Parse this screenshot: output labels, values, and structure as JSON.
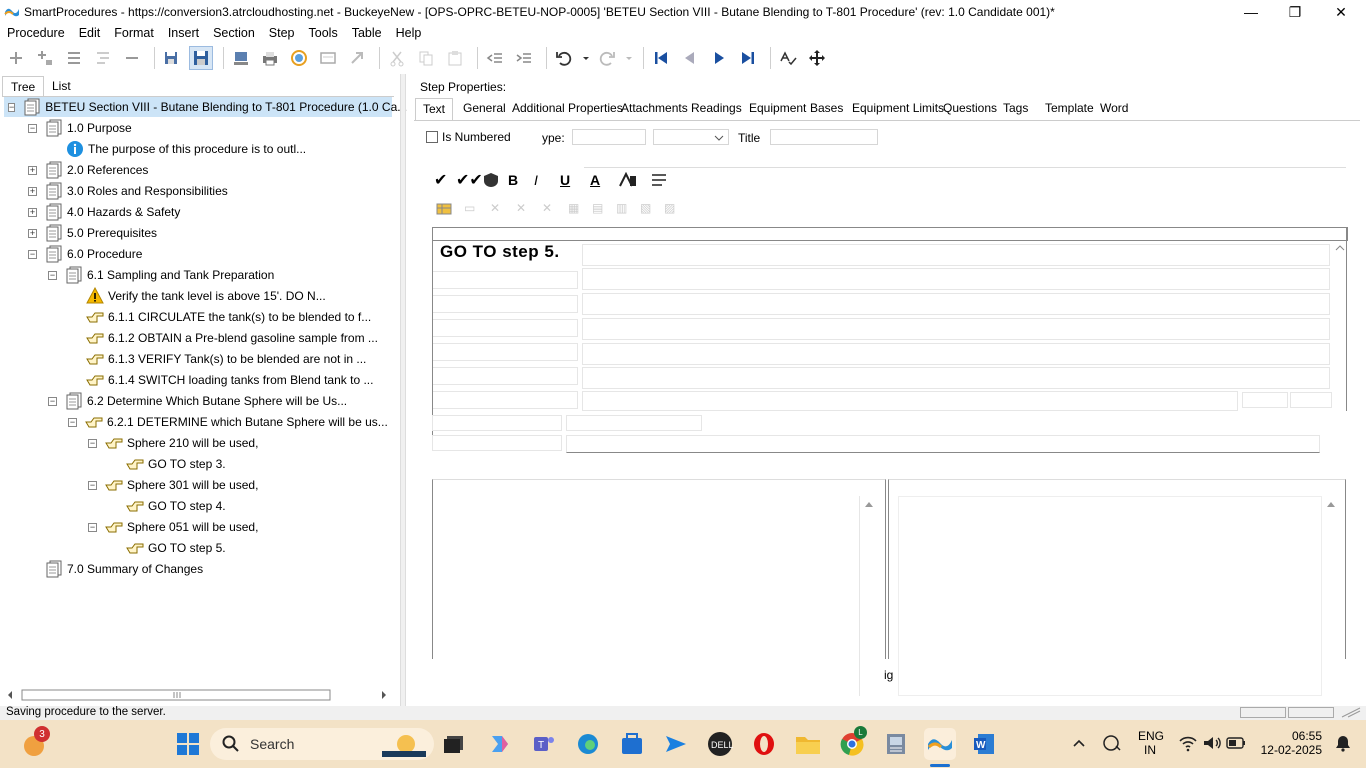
{
  "window": {
    "title": "SmartProcedures - https://conversion3.atrcloudhosting.net - BuckeyeNew - [OPS-OPRC-BETEU-NOP-0005] 'BETEU Section VIII - Butane Blending to T-801 Procedure' (rev: 1.0 Candidate 001)*",
    "minimize": "—",
    "restore": "❐",
    "close": "✕"
  },
  "menu": [
    "Procedure",
    "Edit",
    "Format",
    "Insert",
    "Section",
    "Step",
    "Tools",
    "Table",
    "Help"
  ],
  "left_tabs": [
    "Tree",
    "List"
  ],
  "tree": [
    {
      "label": "BETEU Section VIII - Butane Blending to T-801 Procedure (1.0 Ca...",
      "expander": "−",
      "icon": "document-stack-icon"
    },
    {
      "label": "1.0 Purpose",
      "expander": "−",
      "icon": "document-stack-icon"
    },
    {
      "label": "The purpose of this procedure is to outl...",
      "expander": "",
      "icon": "info-icon"
    },
    {
      "label": "2.0 References",
      "expander": "+",
      "icon": "document-stack-icon"
    },
    {
      "label": "3.0 Roles and Responsibilities",
      "expander": "+",
      "icon": "document-stack-icon"
    },
    {
      "label": "4.0 Hazards & Safety",
      "expander": "+",
      "icon": "document-stack-icon"
    },
    {
      "label": "5.0 Prerequisites",
      "expander": "+",
      "icon": "document-stack-icon"
    },
    {
      "label": "6.0 Procedure",
      "expander": "−",
      "icon": "document-stack-icon"
    },
    {
      "label": "6.1 Sampling and Tank Preparation",
      "expander": "−",
      "icon": "document-stack-icon"
    },
    {
      "label": "Verify the tank level is above 15'. DO N...",
      "expander": "",
      "icon": "warning-icon"
    },
    {
      "label": "6.1.1 CIRCULATE the tank(s) to be blended to f...",
      "expander": "",
      "icon": "pointing-hand-icon"
    },
    {
      "label": "6.1.2 OBTAIN a Pre-blend gasoline sample from ...",
      "expander": "",
      "icon": "pointing-hand-icon"
    },
    {
      "label": "6.1.3 VERIFY Tank(s) to be blended are not in ...",
      "expander": "",
      "icon": "pointing-hand-icon"
    },
    {
      "label": "6.1.4 SWITCH loading tanks from Blend tank to ...",
      "expander": "",
      "icon": "pointing-hand-icon"
    },
    {
      "label": "6.2 Determine Which Butane Sphere will be Us...",
      "expander": "−",
      "icon": "document-stack-icon"
    },
    {
      "label": "6.2.1 DETERMINE which Butane Sphere will be us...",
      "expander": "−",
      "icon": "pointing-hand-icon"
    },
    {
      "label": "Sphere 210 will be used,",
      "expander": "−",
      "icon": "pointing-hand-icon"
    },
    {
      "label": "GO TO step 3.",
      "expander": "",
      "icon": "pointing-hand-icon"
    },
    {
      "label": "Sphere 301 will be used,",
      "expander": "−",
      "icon": "pointing-hand-icon"
    },
    {
      "label": "GO TO step 4.",
      "expander": "",
      "icon": "pointing-hand-icon"
    },
    {
      "label": "Sphere 051 will be used,",
      "expander": "−",
      "icon": "pointing-hand-icon"
    },
    {
      "label": "GO TO step 5.",
      "expander": "",
      "icon": "pointing-hand-icon"
    },
    {
      "label": "7.0 Summary of Changes",
      "expander": "",
      "icon": "document-stack-icon"
    }
  ],
  "step_properties": {
    "heading": "Step Properties:",
    "tabs": [
      "Text",
      "General",
      "Additional Properties",
      "Attachments",
      "Readings",
      "Equipment",
      "Bases",
      "Equipment Limits",
      "Questions",
      "Tags",
      "Template",
      "Word"
    ],
    "is_numbered_label": "Is Numbered",
    "type_label": "ype:",
    "title_label": "Title",
    "editor_text": "GO TO step 5.",
    "fragment_label": "ig"
  },
  "status": "Saving procedure to the server.",
  "taskbar": {
    "search_label": "Search",
    "notification_count": "3",
    "language": "ENG",
    "region": "IN",
    "time": "06:55",
    "date": "12-02-2025",
    "chrome_badge": "L"
  }
}
